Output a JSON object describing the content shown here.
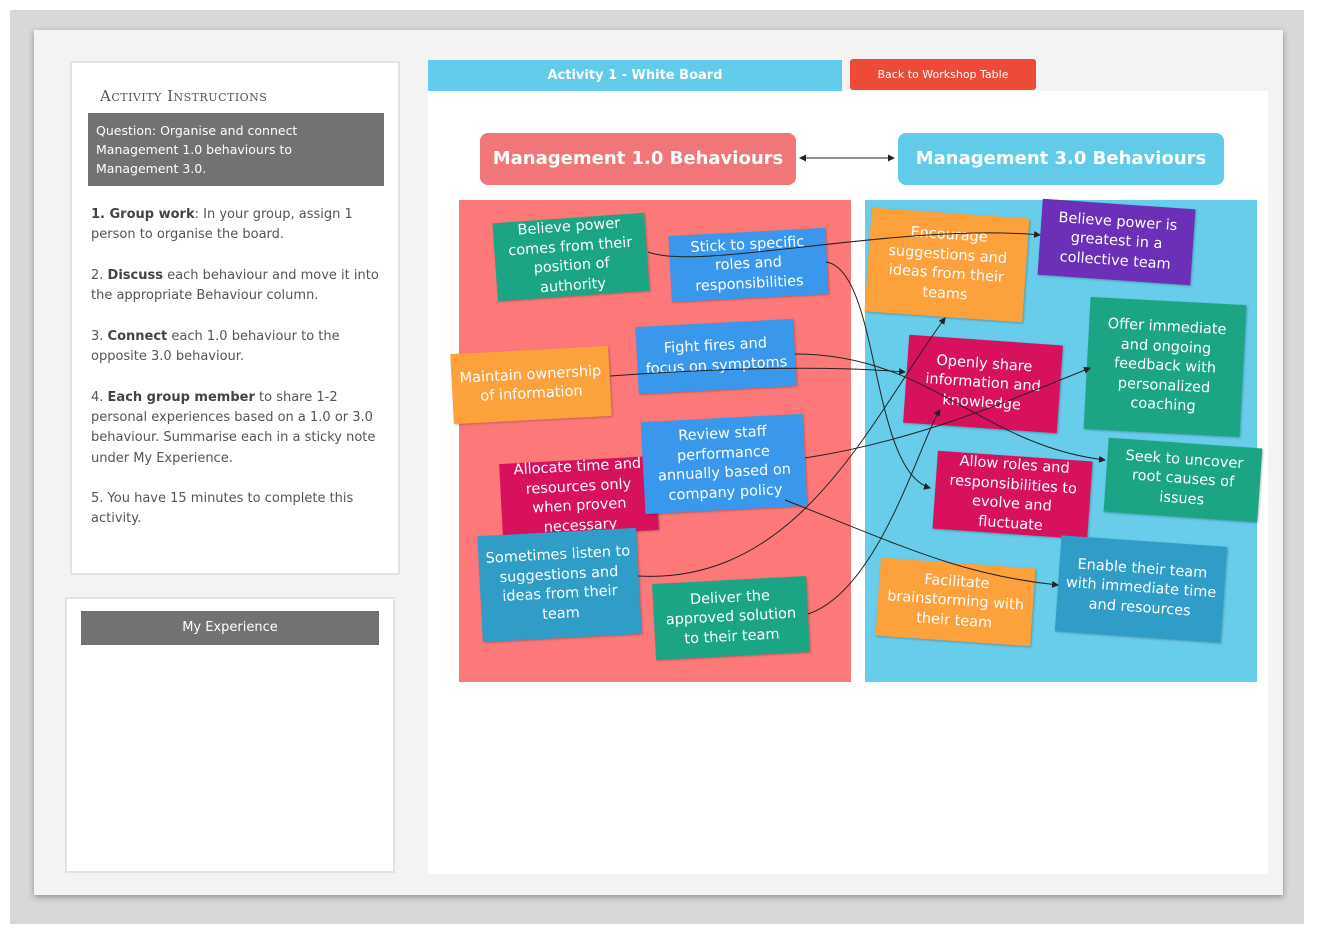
{
  "instructions": {
    "title": "Activity Instructions",
    "question": "Question: Organise and connect Management 1.0 behaviours to Management 3.0.",
    "steps": [
      {
        "num": "1.",
        "bold": "Group work",
        "text": ": In your group, assign 1 person to organise the board."
      },
      {
        "num": "2.",
        "bold": "Discuss",
        "text": " each behaviour and move it into the appropriate Behaviour column."
      },
      {
        "num": "3.",
        "bold": "Connect",
        "text": " each 1.0 behaviour to the opposite 3.0 behaviour."
      },
      {
        "num": "4.",
        "bold": "Each group member",
        "text": " to share 1-2 personal experiences based on a 1.0 or 3.0 behaviour. Summarise each in a sticky note under My Experience."
      },
      {
        "num": "5.",
        "bold": "",
        "text": "You have 15 minutes to complete this activity."
      }
    ]
  },
  "my_experience": {
    "title": "My Experience"
  },
  "board": {
    "tab_label": "Activity 1 - White Board",
    "back_label": "Back to Workshop Table",
    "header_left": "Management 1.0 Behaviours",
    "header_right": "Management 3.0 Behaviours"
  },
  "notes_1": [
    {
      "id": "power-authority",
      "text": "Believe power comes from their position of authority",
      "color": "#1ba584"
    },
    {
      "id": "specific-roles",
      "text": "Stick to specific roles and responsibilities",
      "color": "#3a98ec"
    },
    {
      "id": "fight-fires",
      "text": "Fight fires and focus on symptoms",
      "color": "#3a98ec"
    },
    {
      "id": "ownership-info",
      "text": "Maintain ownership of information",
      "color": "#fca13b"
    },
    {
      "id": "review-staff",
      "text": "Review staff performance annually based on company policy",
      "color": "#3a98ec"
    },
    {
      "id": "allocate-time",
      "text": "Allocate time and resources only when proven necessary",
      "color": "#d8115e"
    },
    {
      "id": "sometimes-listen",
      "text": "Sometimes listen to suggestions and ideas from their team",
      "color": "#2f9dc7"
    },
    {
      "id": "deliver-solution",
      "text": "Deliver the approved solution to their team",
      "color": "#1ba584"
    }
  ],
  "notes_3": [
    {
      "id": "encourage-suggestions",
      "text": "Encourage suggestions and ideas from their teams",
      "color": "#fca13b"
    },
    {
      "id": "power-collective",
      "text": "Believe power is greatest in a collective team",
      "color": "#6b2fb8"
    },
    {
      "id": "offer-feedback",
      "text": "Offer immediate and ongoing feedback with personalized coaching",
      "color": "#1ba584"
    },
    {
      "id": "openly-share",
      "text": "Openly share information and knowledge",
      "color": "#d8115e"
    },
    {
      "id": "allow-roles",
      "text": "Allow roles and responsibilities to evolve and fluctuate",
      "color": "#d8115e"
    },
    {
      "id": "uncover-root",
      "text": "Seek to uncover root causes of issues",
      "color": "#1ba584"
    },
    {
      "id": "enable-team",
      "text": "Enable their team with immediate time and resources",
      "color": "#2f9dc7"
    },
    {
      "id": "facilitate-brainstorming",
      "text": "Facilitate brainstorming with their team",
      "color": "#fca13b"
    }
  ]
}
